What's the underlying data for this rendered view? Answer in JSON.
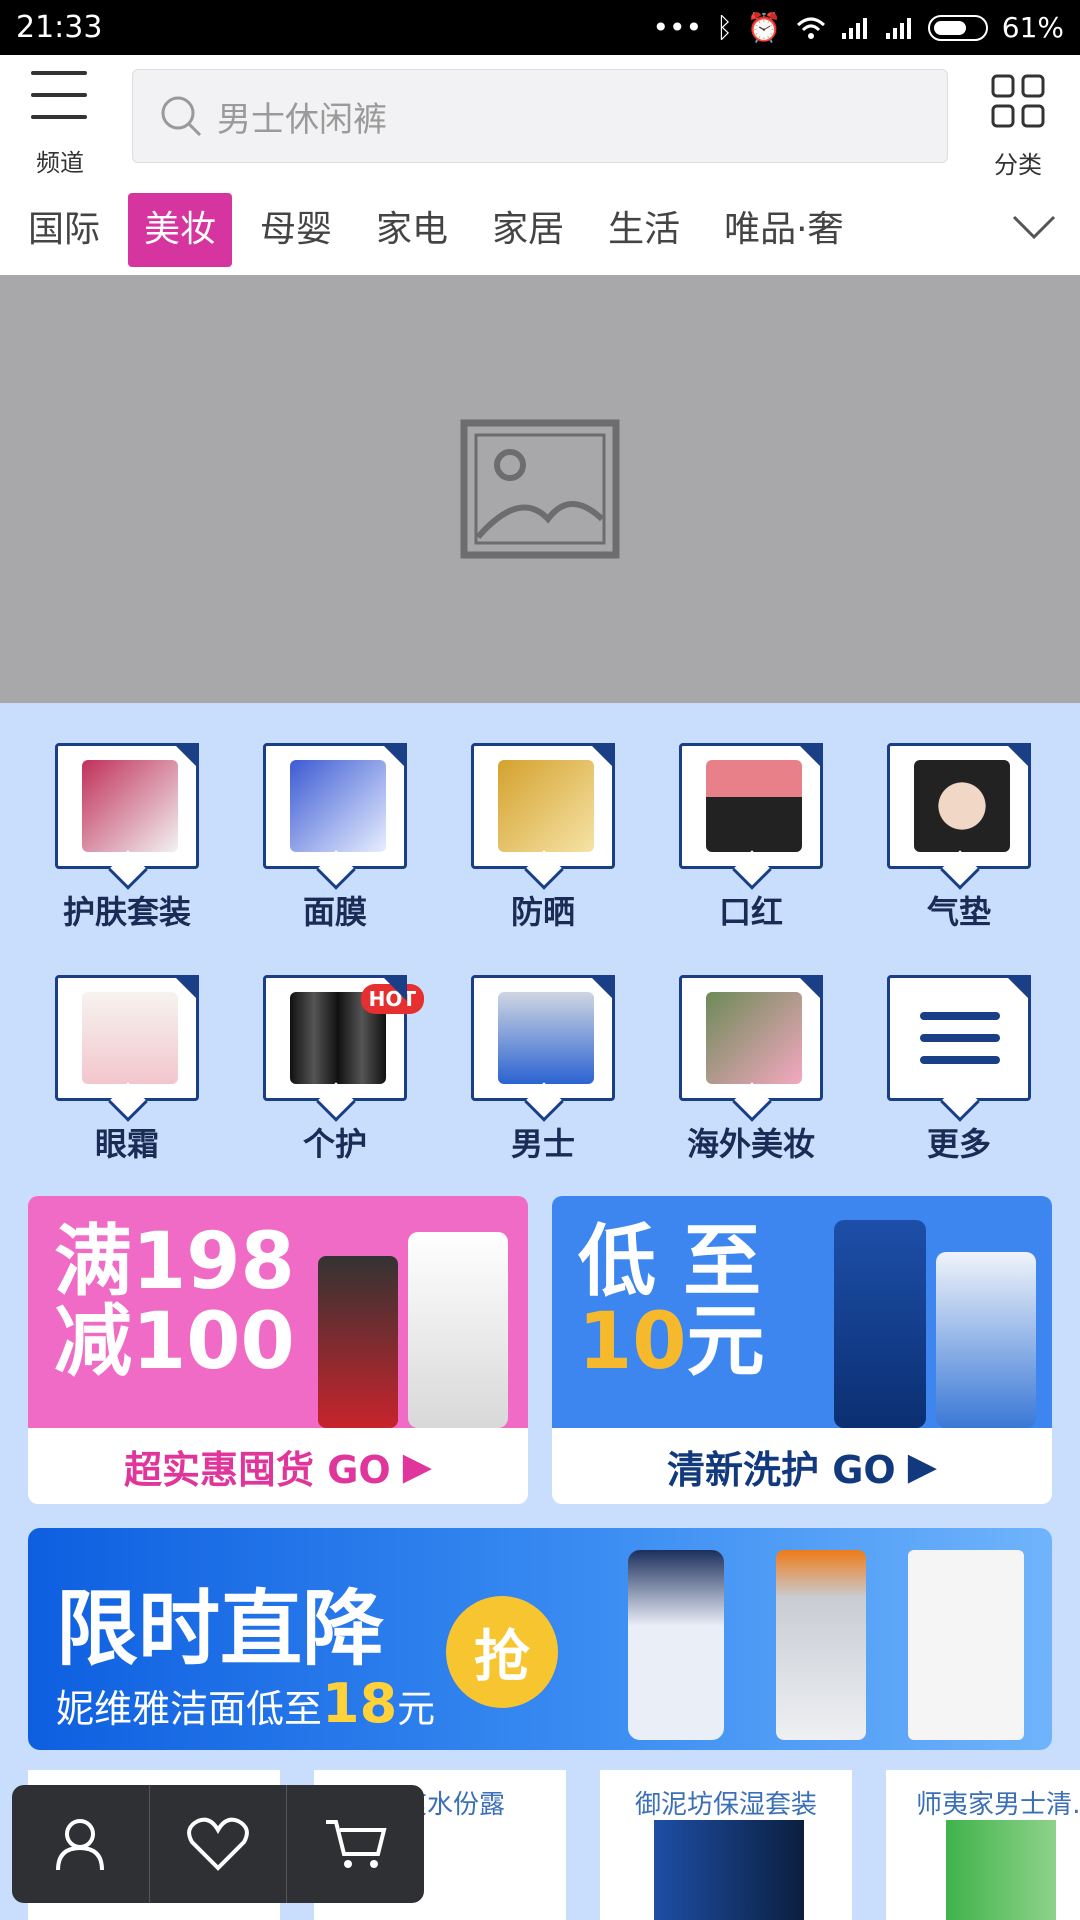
{
  "status": {
    "time": "21:33",
    "battery": "61%"
  },
  "header": {
    "menu_label": "频道",
    "search_placeholder": "男士休闲裤",
    "category_label": "分类"
  },
  "tabs": [
    "国际",
    "美妆",
    "母婴",
    "家电",
    "家居",
    "生活",
    "唯品·奢"
  ],
  "categories": [
    {
      "label": "护肤套装",
      "color": "#c0305a"
    },
    {
      "label": "面膜",
      "color": "#3d5bd3"
    },
    {
      "label": "防晒",
      "color": "#d4a22e"
    },
    {
      "label": "口红",
      "color": "#e8808a"
    },
    {
      "label": "气垫",
      "color": "#333333"
    },
    {
      "label": "眼霜",
      "color": "#f2c6cc"
    },
    {
      "label": "个护",
      "color": "#111111"
    },
    {
      "label": "男士",
      "color": "#2b63d1"
    },
    {
      "label": "海外美妆",
      "color": "#6c8a57"
    },
    {
      "label": "更多",
      "color": "#1a3f86"
    }
  ],
  "hot_badge": "HOT",
  "promos": [
    {
      "line1": "满198",
      "line2": "减100",
      "cta": "超实惠囤货 GO",
      "bg": "#f06bc6",
      "cta_color": "#e0359a"
    },
    {
      "line1": "低 至",
      "line2a": "10",
      "line2b": "元",
      "cta": "清新洗护 GO",
      "bg": "#3d86f0",
      "cta_color": "#12397e"
    }
  ],
  "flash": {
    "title": "限时直降",
    "subtitle_pre": "妮维雅洁面低至",
    "price": "18",
    "unit": "元",
    "badge": "抢"
  },
  "tiles": [
    "…",
    "…爽水份露",
    "御泥坊保湿套装",
    "师夷家男士清…"
  ]
}
